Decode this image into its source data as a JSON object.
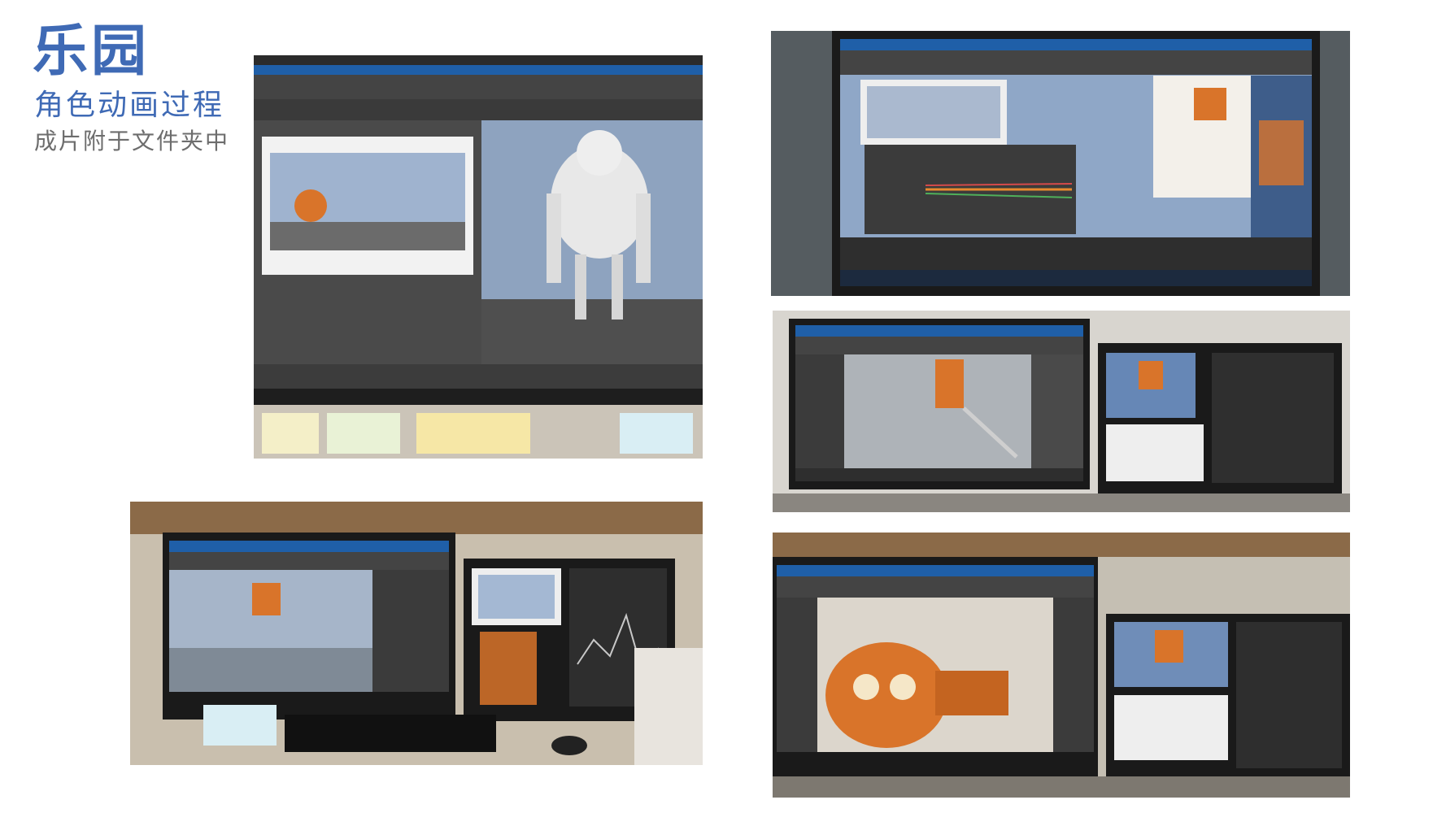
{
  "header": {
    "title": "乐园",
    "subtitle": "角色动画过程",
    "note": "成片附于文件夹中"
  },
  "photos": [
    {
      "id": "photo-1",
      "depicts": "Maya workspace with white robot model and render preview"
    },
    {
      "id": "photo-2",
      "depicts": "monitor with Maya graph editor and orange robot rig"
    },
    {
      "id": "photo-3",
      "depicts": "dual monitors with orange robot hanging on crane"
    },
    {
      "id": "photo-4",
      "depicts": "desk with two monitors, keyboard and mouse"
    },
    {
      "id": "photo-5",
      "depicts": "dual monitors with orange round robot close-up"
    }
  ],
  "colors": {
    "title_blue": "#3f6ab5",
    "note_gray": "#6d6d6d",
    "robot_orange": "#d9742a",
    "maya_dark": "#3b3b3b",
    "viewport_blue": "#9fb3cf"
  }
}
